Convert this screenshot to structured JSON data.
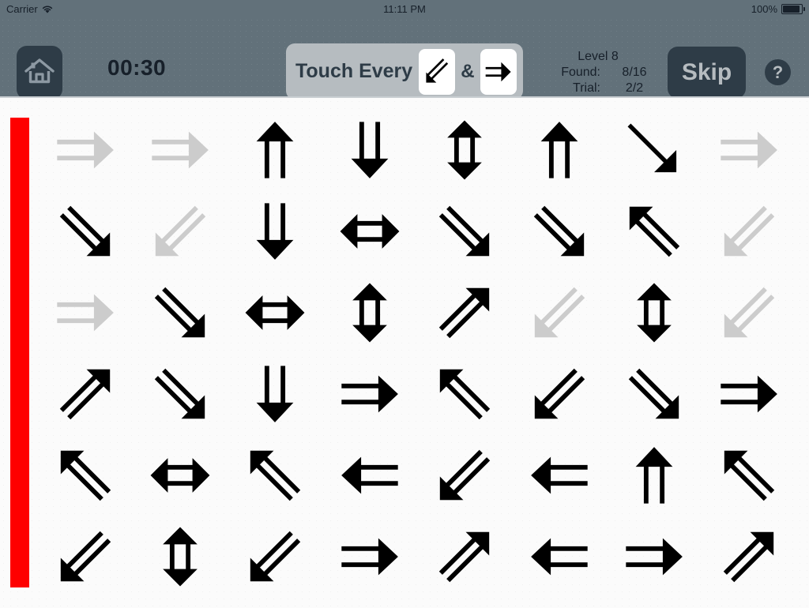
{
  "statusbar": {
    "carrier": "Carrier",
    "wifi_icon": "wifi-icon",
    "time": "11:11 PM",
    "battery_percent": "100%",
    "battery_icon": "battery-full-icon"
  },
  "toolbar": {
    "home_icon": "home-icon",
    "timer": "00:30",
    "prompt_text": "Touch Every",
    "target_a": {
      "icon": "arrow-down-left-double-icon",
      "dir": "down-left",
      "style": "double"
    },
    "conjunction": "&",
    "target_b": {
      "icon": "arrow-right-double-icon",
      "dir": "right",
      "style": "double"
    },
    "level_label": "Level 8",
    "found_label": "Found:",
    "found_value": "8/16",
    "trial_label": "Trial:",
    "trial_value": "2/2",
    "skip_label": "Skip",
    "help_label": "?"
  },
  "play": {
    "progress_color": "#fe0000",
    "found_color": "#cccccc",
    "arrow_color": "#000000",
    "columns": 8,
    "rows": 6,
    "grid": [
      [
        {
          "dir": "right",
          "style": "double",
          "state": "found"
        },
        {
          "dir": "right",
          "style": "double",
          "state": "found"
        },
        {
          "dir": "up",
          "style": "double",
          "state": "active"
        },
        {
          "dir": "down",
          "style": "double",
          "state": "active"
        },
        {
          "dir": "updown",
          "style": "double",
          "state": "active"
        },
        {
          "dir": "up",
          "style": "double",
          "state": "active"
        },
        {
          "dir": "down-right",
          "style": "single",
          "state": "active"
        },
        {
          "dir": "right",
          "style": "double",
          "state": "found"
        }
      ],
      [
        {
          "dir": "down-right",
          "style": "double",
          "state": "active"
        },
        {
          "dir": "down-left",
          "style": "double",
          "state": "found"
        },
        {
          "dir": "down",
          "style": "double",
          "state": "active"
        },
        {
          "dir": "leftright",
          "style": "double",
          "state": "active"
        },
        {
          "dir": "down-right",
          "style": "double",
          "state": "active"
        },
        {
          "dir": "down-right",
          "style": "double",
          "state": "active"
        },
        {
          "dir": "up-left",
          "style": "double",
          "state": "active"
        },
        {
          "dir": "down-left",
          "style": "double",
          "state": "found"
        }
      ],
      [
        {
          "dir": "right",
          "style": "double",
          "state": "found"
        },
        {
          "dir": "down-right",
          "style": "double",
          "state": "active"
        },
        {
          "dir": "leftright",
          "style": "double",
          "state": "active"
        },
        {
          "dir": "updown",
          "style": "double",
          "state": "active"
        },
        {
          "dir": "up-right",
          "style": "double",
          "state": "active"
        },
        {
          "dir": "down-left",
          "style": "double",
          "state": "found"
        },
        {
          "dir": "updown",
          "style": "double",
          "state": "active"
        },
        {
          "dir": "down-left",
          "style": "double",
          "state": "found"
        }
      ],
      [
        {
          "dir": "up-right",
          "style": "double",
          "state": "active"
        },
        {
          "dir": "down-right",
          "style": "double",
          "state": "active"
        },
        {
          "dir": "down",
          "style": "double",
          "state": "active"
        },
        {
          "dir": "right",
          "style": "double",
          "state": "active"
        },
        {
          "dir": "up-left",
          "style": "double",
          "state": "active"
        },
        {
          "dir": "down-left",
          "style": "double",
          "state": "active"
        },
        {
          "dir": "down-right",
          "style": "double",
          "state": "active"
        },
        {
          "dir": "right",
          "style": "double",
          "state": "active"
        }
      ],
      [
        {
          "dir": "up-left",
          "style": "double",
          "state": "active"
        },
        {
          "dir": "leftright",
          "style": "double",
          "state": "active"
        },
        {
          "dir": "up-left",
          "style": "double",
          "state": "active"
        },
        {
          "dir": "left",
          "style": "double",
          "state": "active"
        },
        {
          "dir": "down-left",
          "style": "double",
          "state": "active"
        },
        {
          "dir": "left",
          "style": "double",
          "state": "active"
        },
        {
          "dir": "up",
          "style": "double",
          "state": "active"
        },
        {
          "dir": "up-left",
          "style": "double",
          "state": "active"
        }
      ],
      [
        {
          "dir": "down-left",
          "style": "double",
          "state": "active"
        },
        {
          "dir": "updown",
          "style": "double",
          "state": "active"
        },
        {
          "dir": "down-left",
          "style": "double",
          "state": "active"
        },
        {
          "dir": "right",
          "style": "double",
          "state": "active"
        },
        {
          "dir": "up-right",
          "style": "double",
          "state": "active"
        },
        {
          "dir": "left",
          "style": "double",
          "state": "active"
        },
        {
          "dir": "right",
          "style": "double",
          "state": "active"
        },
        {
          "dir": "up-right",
          "style": "double",
          "state": "active"
        }
      ]
    ]
  }
}
